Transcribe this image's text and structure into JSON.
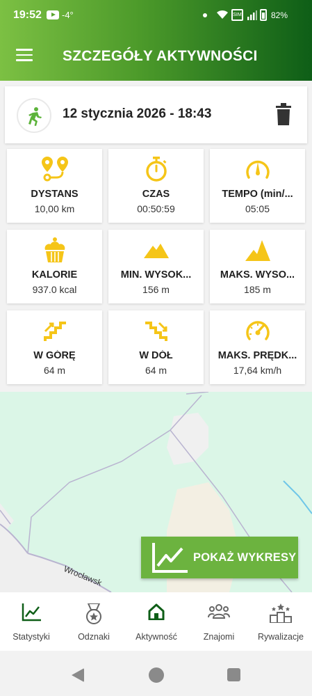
{
  "status_bar": {
    "time": "19:52",
    "temperature": "-4°",
    "battery": "82%"
  },
  "app_bar": {
    "title": "SZCZEGÓŁY AKTYWNOŚCI",
    "menu_icon": "hamburger-menu-icon"
  },
  "activity": {
    "date": "12 stycznia 2026 - 18:43",
    "type_icon": "running-person-icon",
    "delete_icon": "trash-icon"
  },
  "stats": [
    {
      "label": "DYSTANS",
      "value": "10,00 km",
      "icon": "route-pins-icon"
    },
    {
      "label": "CZAS",
      "value": "00:50:59",
      "icon": "stopwatch-icon"
    },
    {
      "label": "TEMPO (min/...",
      "value": "05:05",
      "icon": "pace-gauge-icon"
    },
    {
      "label": "KALORIE",
      "value": "937.0 kcal",
      "icon": "cupcake-icon"
    },
    {
      "label": "MIN. WYSOK...",
      "value": "156 m",
      "icon": "mountain-low-icon"
    },
    {
      "label": "MAKS. WYSO...",
      "value": "185 m",
      "icon": "mountain-high-icon"
    },
    {
      "label": "W GÓRĘ",
      "value": "64 m",
      "icon": "stairs-up-icon"
    },
    {
      "label": "W DÓŁ",
      "value": "64 m",
      "icon": "stairs-down-icon"
    },
    {
      "label": "MAKS. PRĘDK...",
      "value": "17,64 km/h",
      "icon": "speedometer-icon"
    }
  ],
  "map": {
    "road_label": "Wrocławsk"
  },
  "chart_button": {
    "label": "POKAŻ WYKRESY",
    "icon": "line-chart-icon"
  },
  "bottom_nav": [
    {
      "label": "Statystyki",
      "icon": "trend-chart-icon",
      "active": false
    },
    {
      "label": "Odznaki",
      "icon": "medal-icon",
      "active": false
    },
    {
      "label": "Aktywność",
      "icon": "home-icon",
      "active": true
    },
    {
      "label": "Znajomi",
      "icon": "friends-icon",
      "active": false
    },
    {
      "label": "Rywalizacje",
      "icon": "podium-icon",
      "active": false
    }
  ],
  "colors": {
    "accent_green": "#6cb33f",
    "dark_green": "#0e5e17",
    "stat_icon_yellow": "#f5c518",
    "map_background": "#dbf6e7"
  }
}
